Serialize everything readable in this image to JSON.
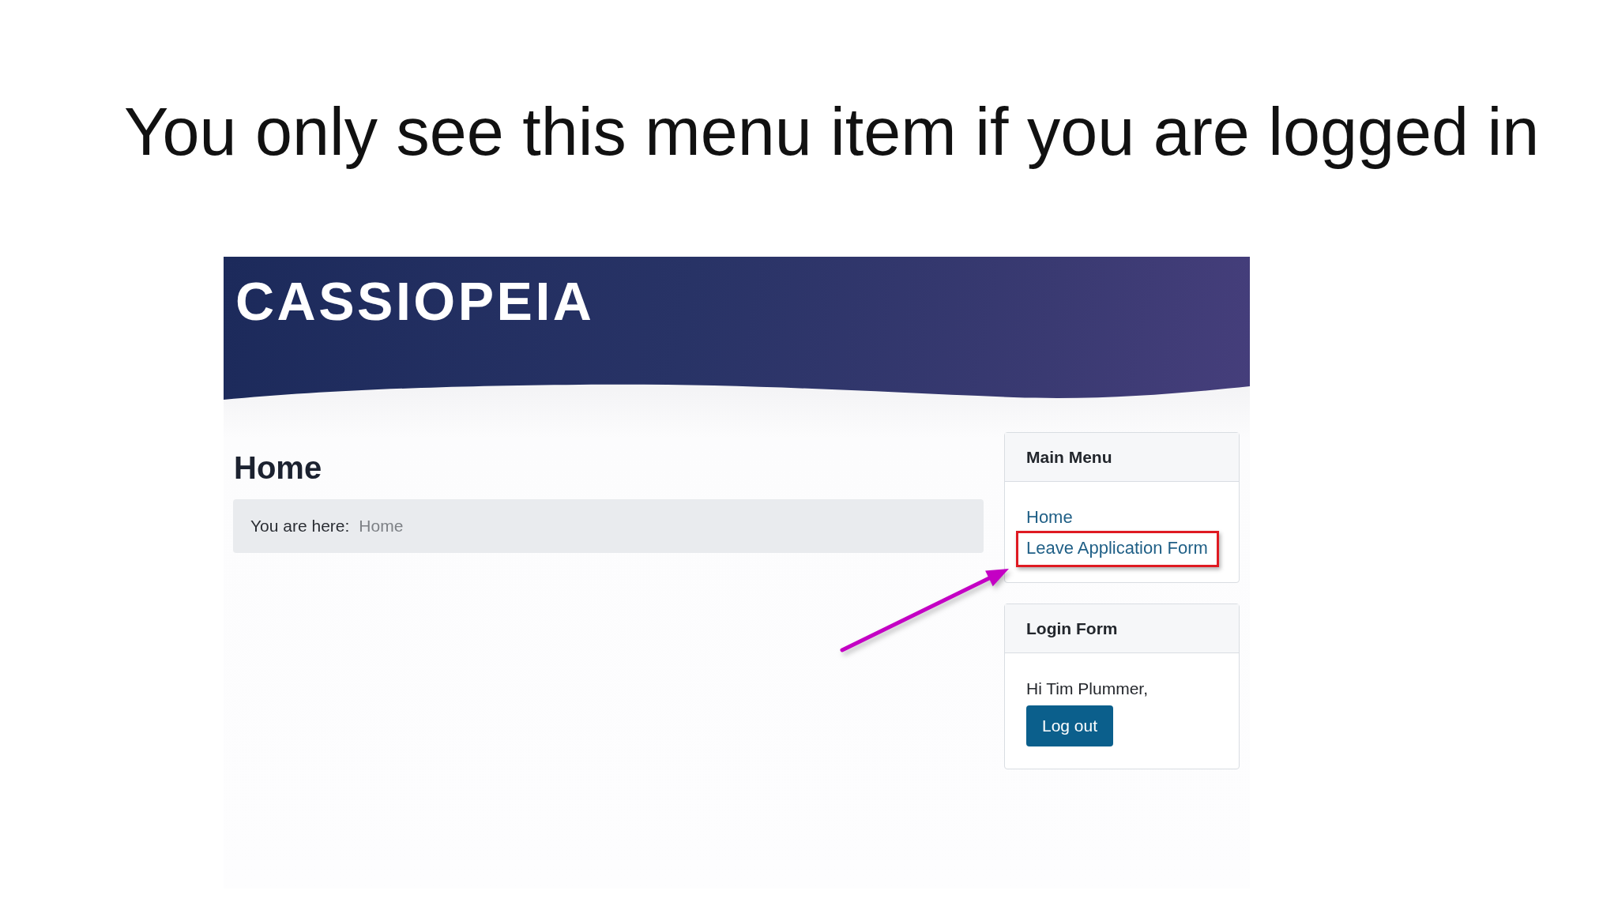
{
  "slide": {
    "title": "You only see this menu item if you are logged in"
  },
  "site": {
    "logo": "CASSIOPEIA"
  },
  "page": {
    "heading": "Home",
    "breadcrumb": {
      "label": "You are here:",
      "items": [
        "Home"
      ]
    }
  },
  "modules": [
    {
      "kind": "menu",
      "title": "Main Menu",
      "items": [
        {
          "label": "Home",
          "highlighted": false
        },
        {
          "label": "Leave Application Form",
          "highlighted": true
        }
      ]
    },
    {
      "kind": "login",
      "title": "Login Form",
      "greeting": "Hi Tim Plummer,",
      "button": "Log out"
    }
  ]
}
